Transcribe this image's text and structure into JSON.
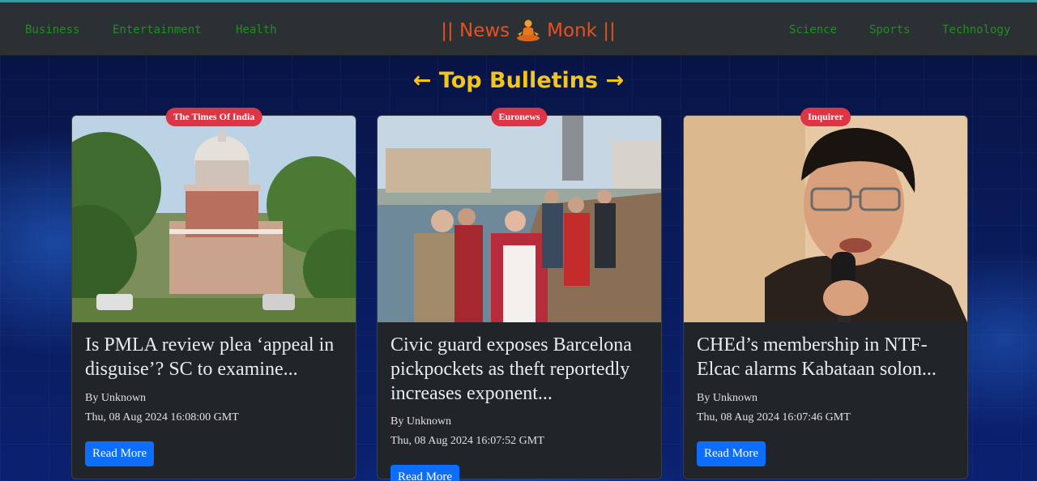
{
  "navbar": {
    "left_links": [
      "Business",
      "Entertainment",
      "Health"
    ],
    "right_links": [
      "Science",
      "Sports",
      "Technology"
    ],
    "brand_left": "|| News",
    "brand_icon": "meditating-monk-icon",
    "brand_right": "Monk ||"
  },
  "section": {
    "title": "← Top Bulletins →"
  },
  "cards": [
    {
      "source": "The Times Of India",
      "image": "supreme-court-building",
      "title": "Is PMLA review plea ‘appeal in disguise’? SC to examine...",
      "author": "By Unknown",
      "date": "Thu, 08 Aug 2024 16:08:00 GMT",
      "button": "Read More"
    },
    {
      "source": "Euronews",
      "image": "tourists-on-barcelona-boardwalk",
      "title": "Civic guard exposes Barcelona pickpockets as theft reportedly increases exponent...",
      "author": "By Unknown",
      "date": "Thu, 08 Aug 2024 16:07:52 GMT",
      "button": "Read More"
    },
    {
      "source": "Inquirer",
      "image": "man-speaking-into-microphone",
      "title": "CHEd’s membership in NTF-Elcac alarms Kabataan solon...",
      "author": "By Unknown",
      "date": "Thu, 08 Aug 2024 16:07:46 GMT",
      "button": "Read More"
    }
  ],
  "colors": {
    "navbar_bg": "#2b3035",
    "nav_link": "#1f8f1f",
    "brand": "#e8501e",
    "title": "#f5c518",
    "badge": "#dc3545",
    "card_bg": "#212529",
    "button": "#0d6efd"
  }
}
